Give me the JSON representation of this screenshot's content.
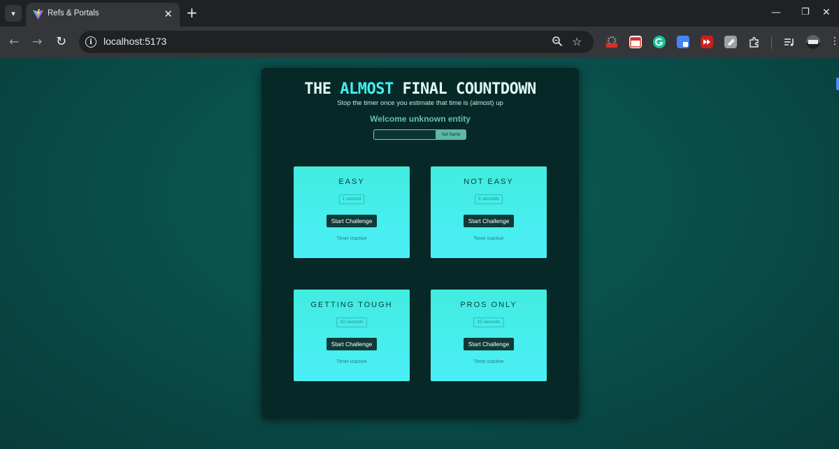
{
  "browser": {
    "tab_title": "Refs & Portals",
    "url": "localhost:5173",
    "icons": [
      "tab-list-icon",
      "vite-favicon",
      "close-icon",
      "plus-icon",
      "minimize-icon",
      "restore-icon",
      "window-close-icon",
      "back-arrow-icon",
      "forward-arrow-icon",
      "reload-icon",
      "site-info-icon",
      "zoom-icon",
      "star-icon",
      "extensions-icon",
      "media-icon",
      "profile-avatar"
    ]
  },
  "app": {
    "title_start": "THE ",
    "title_accent": "ALMOST",
    "title_end": " FINAL COUNTDOWN",
    "subtitle": "Stop the timer once you estimate that time is (almost) up",
    "welcome": "Welcome unknown entity",
    "name_input_value": "",
    "set_name_label": "Set Name",
    "accent_color": "#3ff0f2"
  },
  "challenges": [
    {
      "title": "EASY",
      "duration": "1 second",
      "button": "Start Challenge",
      "status": "Timer inactive"
    },
    {
      "title": "NOT EASY",
      "duration": "5 seconds",
      "button": "Start Challenge",
      "status": "Timer inactive"
    },
    {
      "title": "GETTING TOUGH",
      "duration": "10 seconds",
      "button": "Start Challenge",
      "status": "Timer inactive"
    },
    {
      "title": "PROS ONLY",
      "duration": "15 seconds",
      "button": "Start Challenge",
      "status": "Timer inactive"
    }
  ]
}
